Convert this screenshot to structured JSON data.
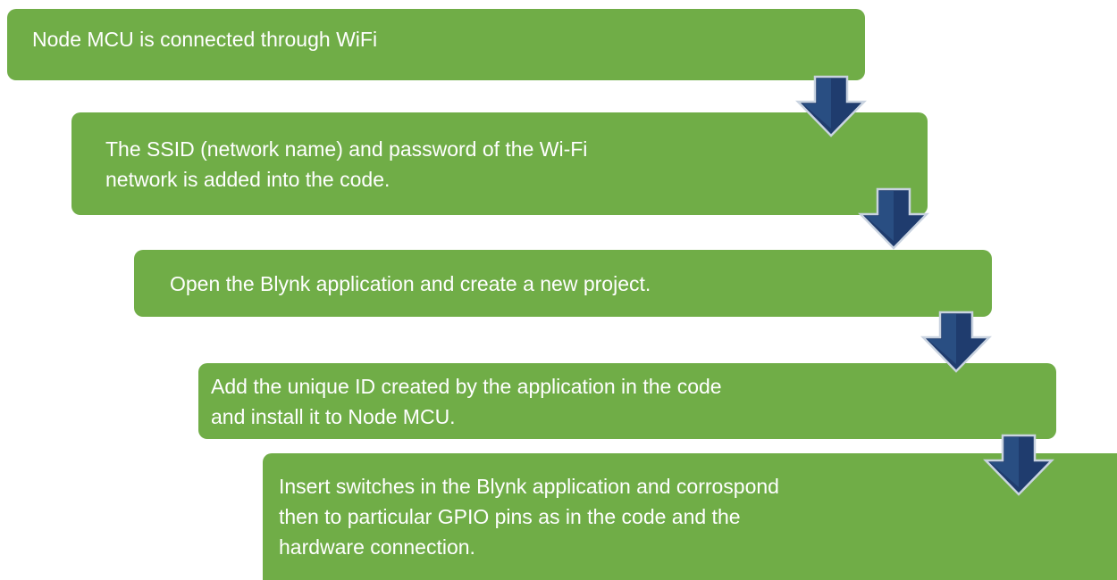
{
  "colors": {
    "box_fill": "#70ad47",
    "text": "#ffffff",
    "arrow_fill": "#1f3c6e",
    "arrow_highlight": "#35639b",
    "arrow_outline": "#c9d3e0"
  },
  "flow": {
    "steps": [
      {
        "label": "Node MCU is connected through WiFi"
      },
      {
        "label": "The SSID (network name) and password of the Wi-Fi\nnetwork is added into the code."
      },
      {
        "label": "Open the Blynk application and create a new project."
      },
      {
        "label": "Add the unique ID created by the application in the code\nand install it to Node MCU."
      },
      {
        "label": "Insert switches in the Blynk application and corrospond\nthen to particular GPIO pins as in the code and the\nhardware connection."
      }
    ],
    "arrow_icon": "down-arrow-icon"
  }
}
